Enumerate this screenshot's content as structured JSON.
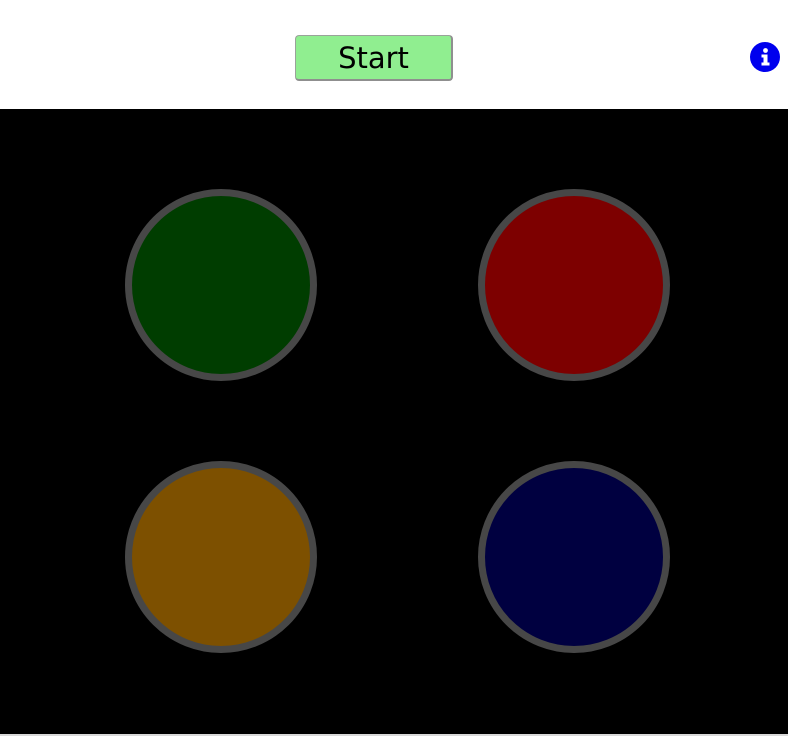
{
  "controls": {
    "start_label": "Start",
    "info_icon": "info-circle-icon"
  },
  "colors": {
    "start_button": "#90ee90",
    "info_icon": "#0000ee",
    "board_background": "#000000",
    "pad_border": "#474747"
  },
  "pads": [
    {
      "name": "green",
      "color": "#003d00"
    },
    {
      "name": "red",
      "color": "#7d0000"
    },
    {
      "name": "yellow",
      "color": "#7d5000"
    },
    {
      "name": "blue",
      "color": "#000040"
    }
  ]
}
